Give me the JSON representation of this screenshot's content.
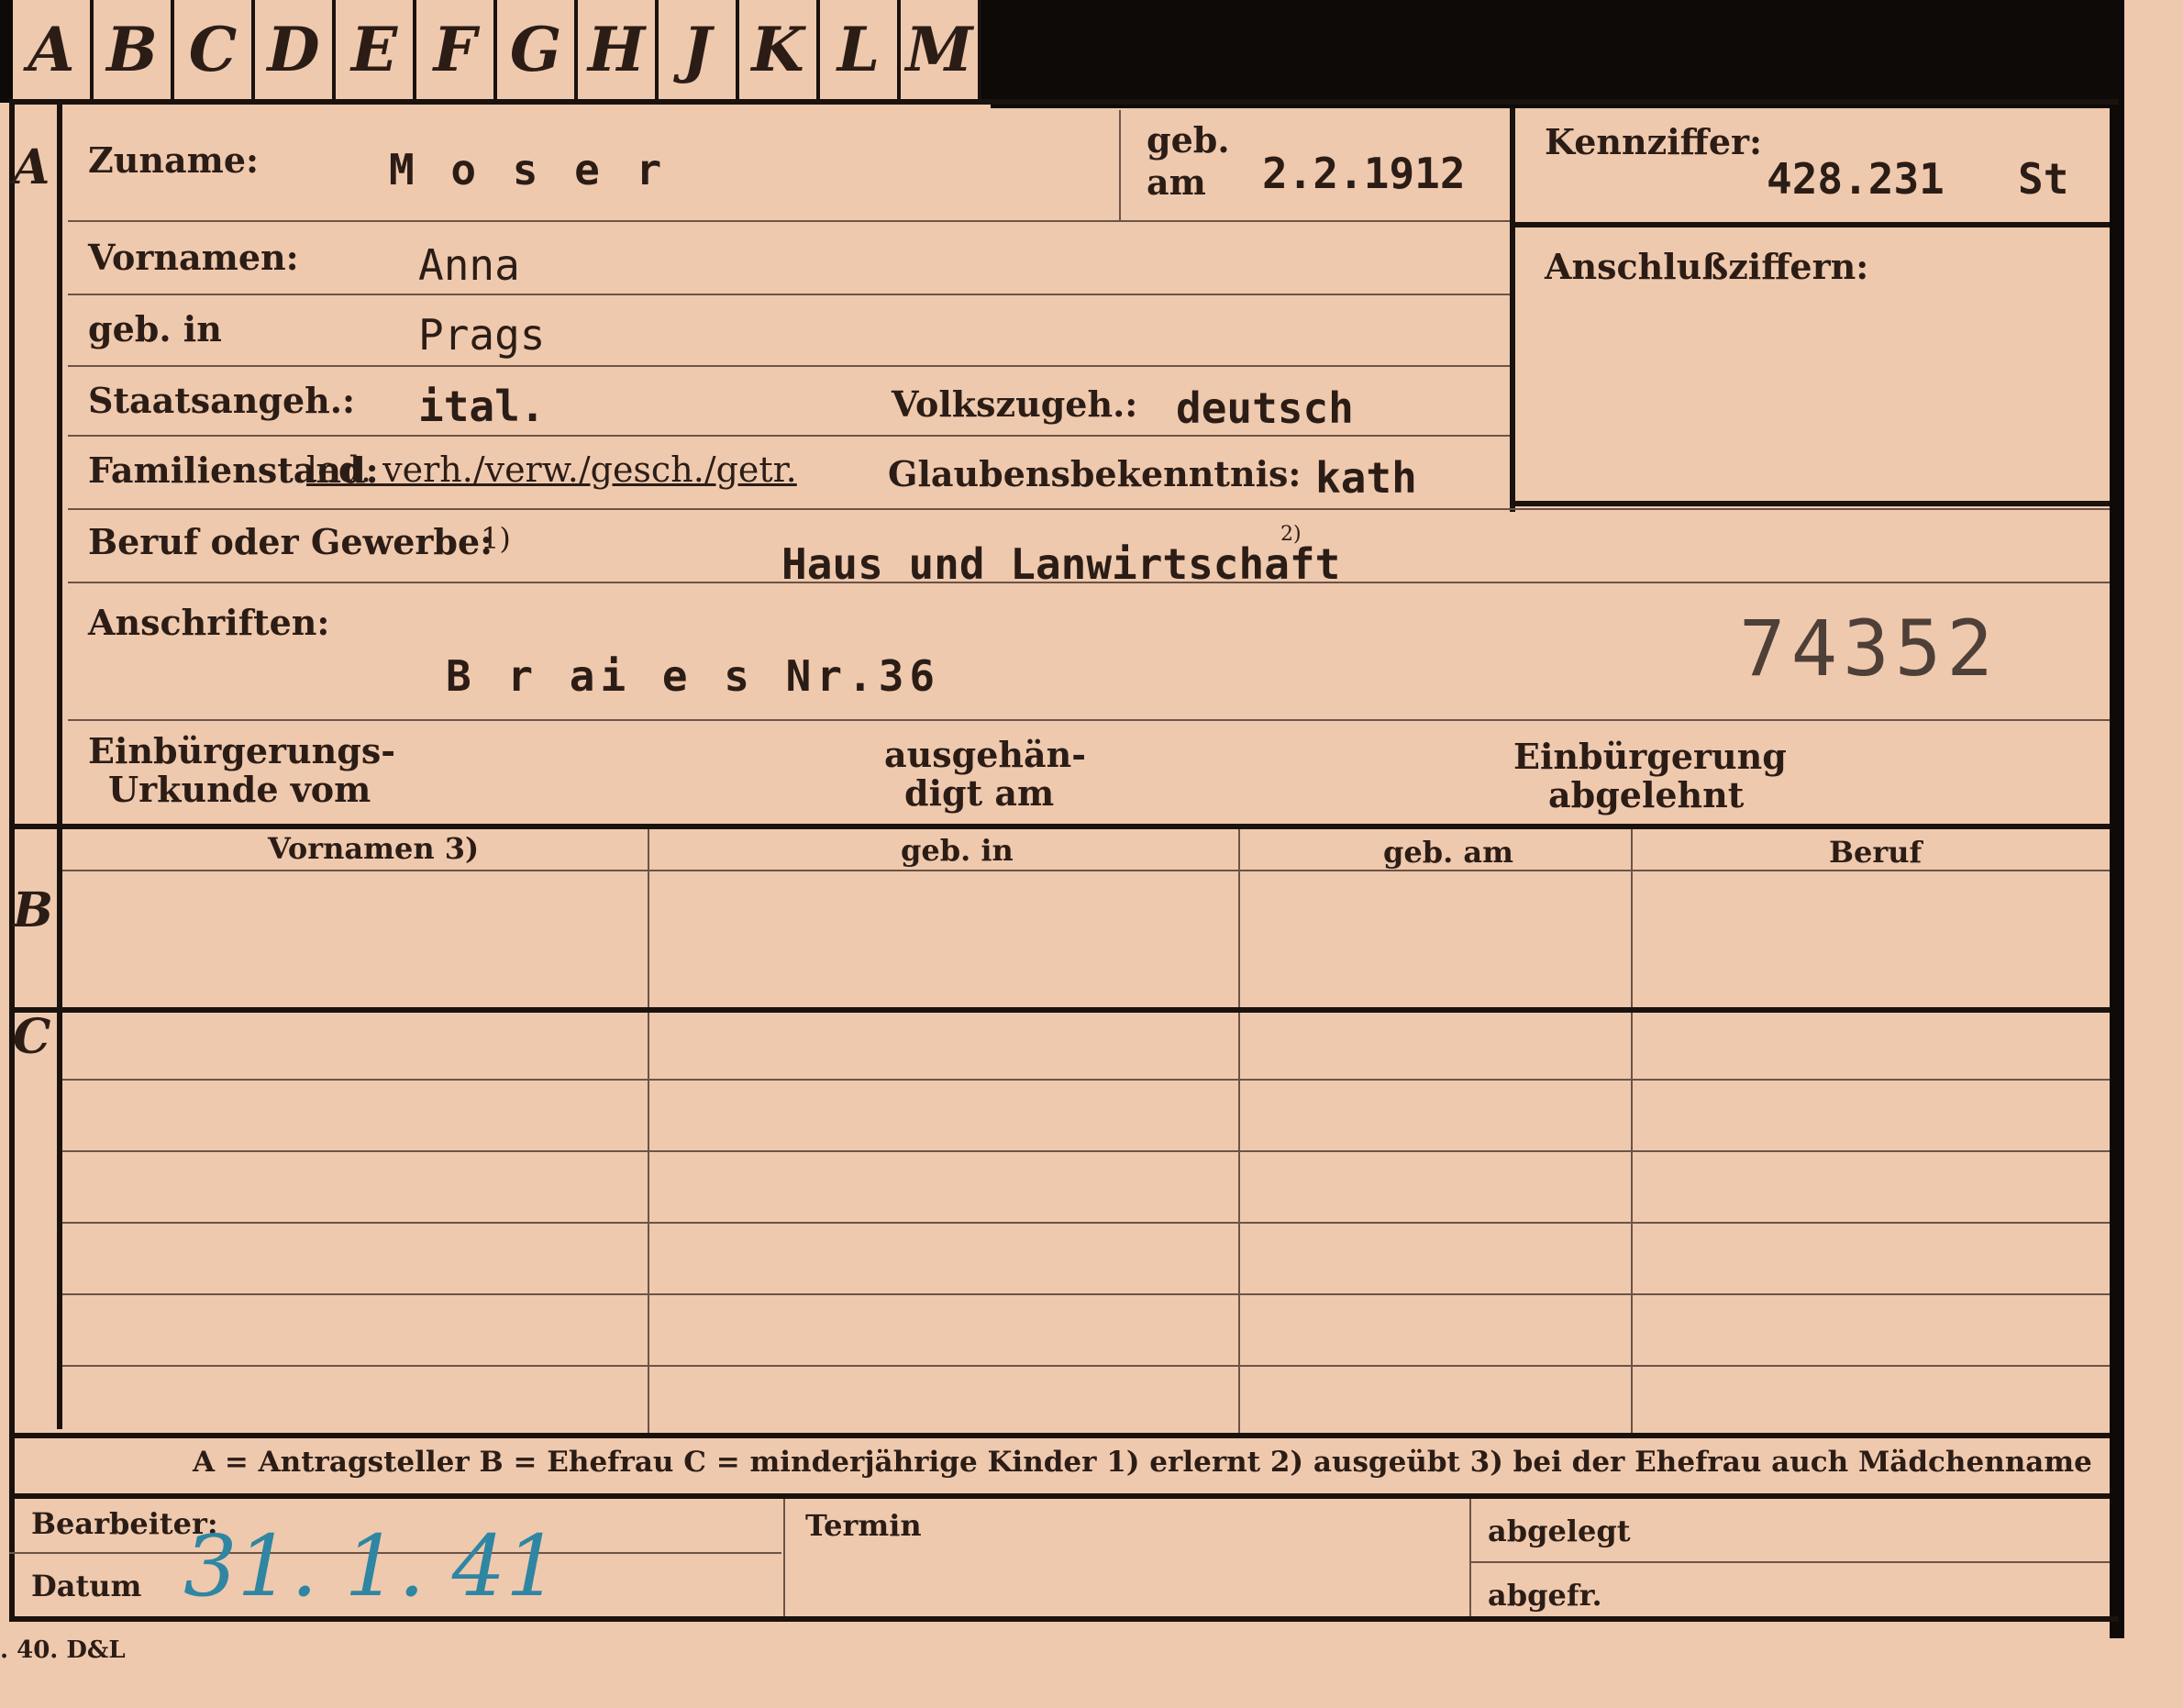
{
  "tabs": [
    "A",
    "B",
    "C",
    "D",
    "E",
    "F",
    "G",
    "H",
    "J",
    "K",
    "L",
    "M"
  ],
  "section_letters": {
    "a": "A",
    "b": "B",
    "c": "C"
  },
  "labels": {
    "zuname": "Zuname:",
    "geb_am_1": "geb.",
    "geb_am_2": "am",
    "kennziffer": "Kennziffer:",
    "anschlussziffern": "Anschlußziffern:",
    "vornamen": "Vornamen:",
    "geb_in": "geb. in",
    "staatsangeh": "Staatsangeh.:",
    "volkszugeh": "Volkszugeh.:",
    "familienstand": "Familienstand:",
    "familienstand_options": "led. verh./verw./gesch./getr.",
    "glaubensbekenntnis": "Glaubensbekenntnis:",
    "beruf": "Beruf oder Gewerbe:",
    "beruf_note": "1)",
    "beruf_note2": "2)",
    "anschriften": "Anschriften:",
    "einb_urkunde_1": "Einbürgerungs-",
    "einb_urkunde_2": "Urkunde vom",
    "ausgehaendigt_1": "ausgehän-",
    "ausgehaendigt_2": "digt am",
    "einb_abgelehnt_1": "Einbürgerung",
    "einb_abgelehnt_2": "abgelehnt",
    "col_vornamen": "Vornamen 3)",
    "col_geb_in": "geb. in",
    "col_geb_am": "geb. am",
    "col_beruf": "Beruf",
    "legend": "A = Antragsteller   B = Ehefrau   C = minderjährige Kinder   1) erlernt   2) ausgeübt   3) bei der Ehefrau auch Mädchenname",
    "bearbeiter": "Bearbeiter:",
    "datum": "Datum",
    "termin": "Termin",
    "abgelegt": "abgelegt",
    "abgefr": "abgefr.",
    "printer": ". 40. D&L"
  },
  "values": {
    "zuname": "M o s e r",
    "geb_am": "2.2.1912",
    "kennziffer": "428.231",
    "kennziffer_suffix": "St",
    "vornamen": "Anna",
    "geb_in": "Prags",
    "staatsangeh": "ital.",
    "volkszugeh": "deutsch",
    "glaubensbekenntnis": "kath",
    "beruf": "Haus und Lanwirtschaft",
    "anschrift": "B r ai e s  Nr.36",
    "stamp_number": "74352",
    "datum_handwritten": "31. 1. 41"
  },
  "colors": {
    "card": "#efc9ae",
    "ink": "#2b1d16",
    "handwriting": "#2f86a2",
    "border": "#1a120e"
  }
}
